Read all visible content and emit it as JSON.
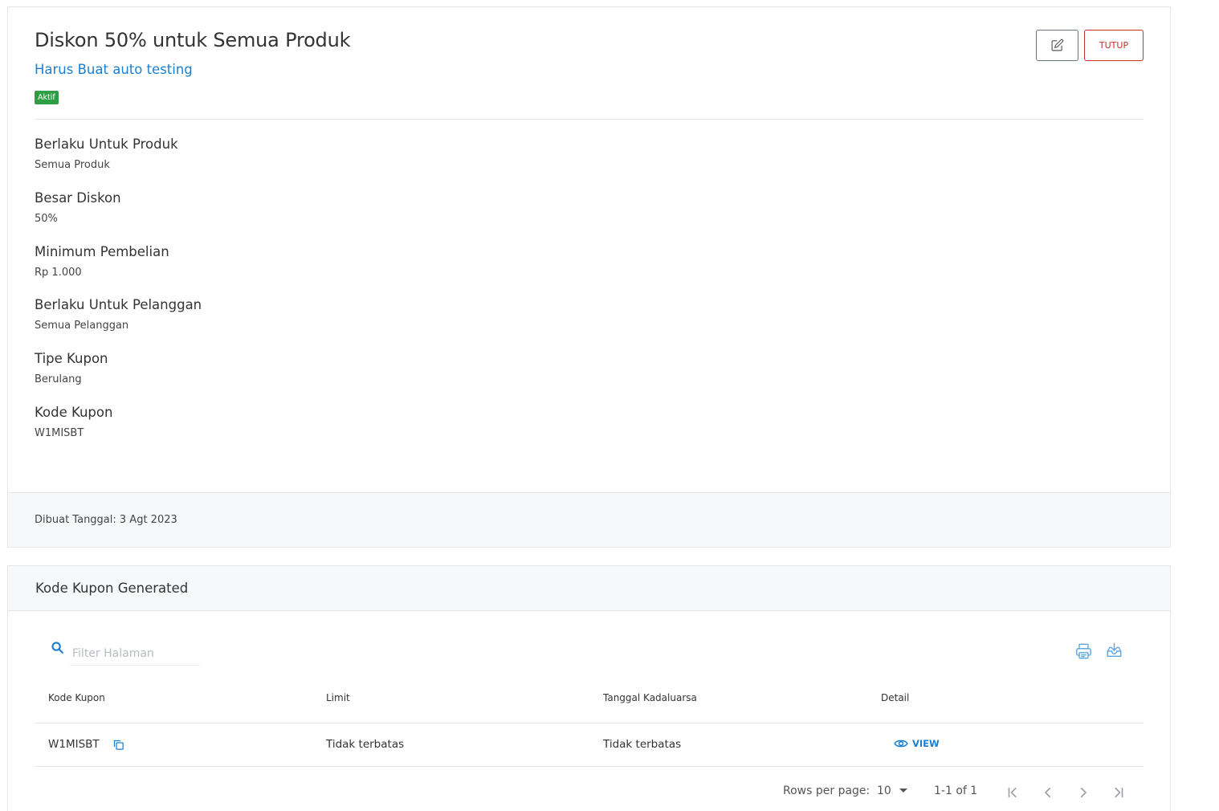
{
  "coupon": {
    "title": "Diskon 50% untuk Semua Produk",
    "subtitle": "Harus Buat auto testing",
    "status_badge": "Aktif",
    "close_label": "TUTUP",
    "fields": [
      {
        "label": "Berlaku Untuk Produk",
        "value": "Semua Produk"
      },
      {
        "label": "Besar Diskon",
        "value": "50%"
      },
      {
        "label": "Minimum Pembelian",
        "value": "Rp 1.000"
      },
      {
        "label": "Berlaku Untuk Pelanggan",
        "value": "Semua Pelanggan"
      },
      {
        "label": "Tipe Kupon",
        "value": "Berulang"
      },
      {
        "label": "Kode Kupon",
        "value": "W1MISBT"
      }
    ],
    "created_text": "Dibuat Tanggal: 3 Agt 2023"
  },
  "generated": {
    "title": "Kode Kupon Generated",
    "search_placeholder": "Filter Halaman",
    "columns": [
      "Kode Kupon",
      "Limit",
      "Tanggal Kadaluarsa",
      "Detail"
    ],
    "rows": [
      {
        "code": "W1MISBT",
        "limit": "Tidak terbatas",
        "expiry": "Tidak terbatas",
        "detail": "VIEW"
      }
    ],
    "pagination": {
      "rows_per_page_label": "Rows per page:",
      "rows_per_page_value": "10",
      "range_text": "1-1 of 1"
    }
  },
  "colors": {
    "accent": "#1a7fd0",
    "danger": "#c9302c",
    "success": "#2f9e44"
  },
  "icons": [
    "edit-icon",
    "search-icon",
    "print-icon",
    "download-icon",
    "copy-icon",
    "eye-icon",
    "first-page-icon",
    "prev-page-icon",
    "next-page-icon",
    "last-page-icon",
    "dropdown-arrow-icon"
  ]
}
